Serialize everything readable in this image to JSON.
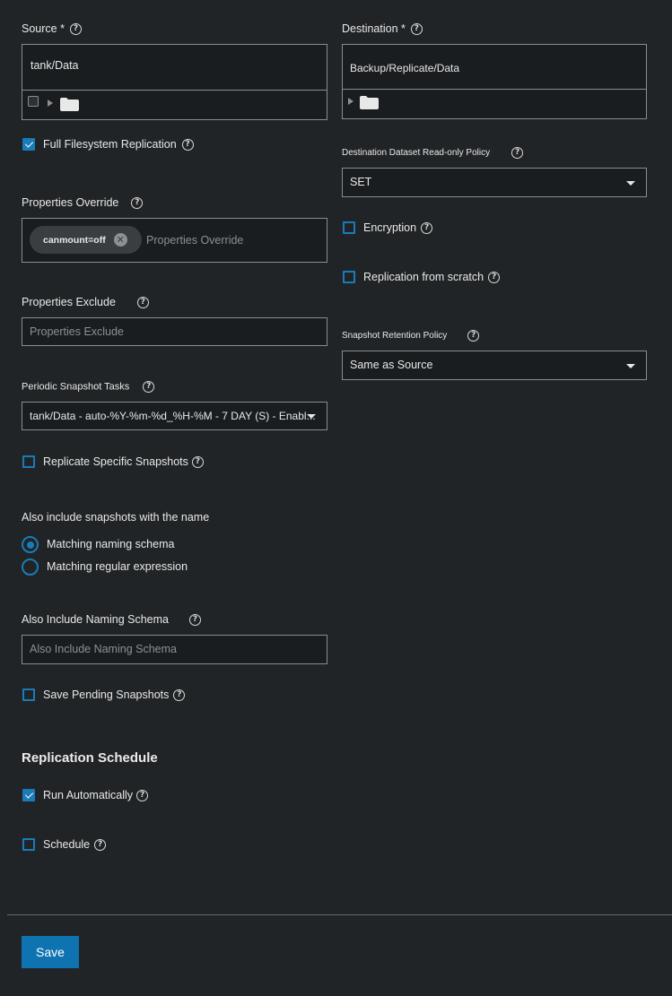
{
  "source": {
    "label": "Source *",
    "value": "tank/Data"
  },
  "destination": {
    "label": "Destination *",
    "value": "Backup/Replicate/Data"
  },
  "full_fs_replication": {
    "label": "Full Filesystem Replication",
    "checked": true
  },
  "dest_readonly_policy": {
    "label": "Destination Dataset Read-only Policy",
    "value": "SET"
  },
  "properties_override": {
    "label": "Properties Override",
    "chips": [
      "canmount=off"
    ],
    "placeholder": "Properties Override"
  },
  "encryption": {
    "label": "Encryption",
    "checked": false
  },
  "replication_from_scratch": {
    "label": "Replication from scratch",
    "checked": false
  },
  "properties_exclude": {
    "label": "Properties Exclude",
    "placeholder": "Properties Exclude"
  },
  "snapshot_retention_policy": {
    "label": "Snapshot Retention Policy",
    "value": "Same as Source"
  },
  "periodic_snapshot_tasks": {
    "label": "Periodic Snapshot Tasks",
    "value": "tank/Data - auto-%Y-%m-%d_%H-%M - 7 DAY (S) - Enabl..."
  },
  "replicate_specific_snapshots": {
    "label": "Replicate Specific Snapshots",
    "checked": false
  },
  "also_include": {
    "label": "Also include snapshots with the name",
    "options": [
      "Matching naming schema",
      "Matching regular expression"
    ],
    "selected": "Matching naming schema"
  },
  "also_include_naming_schema": {
    "label": "Also Include Naming Schema",
    "placeholder": "Also Include Naming Schema"
  },
  "save_pending_snapshots": {
    "label": "Save Pending Snapshots",
    "checked": false
  },
  "replication_schedule": {
    "title": "Replication Schedule",
    "run_automatically": {
      "label": "Run Automatically",
      "checked": true
    },
    "schedule": {
      "label": "Schedule",
      "checked": false
    }
  },
  "save_button": {
    "label": "Save"
  },
  "help_glyph": "?",
  "close_glyph": "✕",
  "colors": {
    "accent": "#1a7bb9",
    "button": "#0f73b2",
    "background": "#212426"
  }
}
